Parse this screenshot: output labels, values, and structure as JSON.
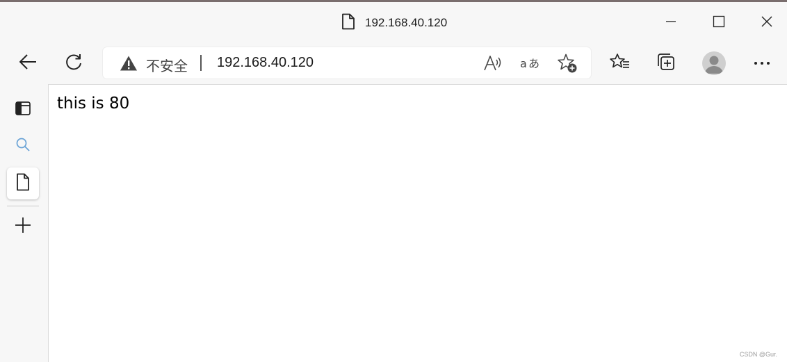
{
  "window": {
    "title": "192.168.40.120"
  },
  "toolbar": {
    "security_label": "不安全",
    "url": "192.168.40.120"
  },
  "page": {
    "body_text": "this is 80"
  },
  "watermark": "CSDN @Gur.",
  "icons": {
    "title": "page-icon",
    "back": "back-arrow-icon",
    "refresh": "refresh-icon",
    "warning": "warning-icon",
    "read_aloud": "read-aloud-icon",
    "translate": "translate-icon",
    "add_favorite": "add-favorite-icon",
    "favorites": "favorites-icon",
    "collections": "collections-icon",
    "profile": "profile-icon",
    "more": "more-icon",
    "tab_actions": "tab-actions-icon",
    "search": "search-icon",
    "tab": "page-icon",
    "new_tab": "plus-icon"
  }
}
